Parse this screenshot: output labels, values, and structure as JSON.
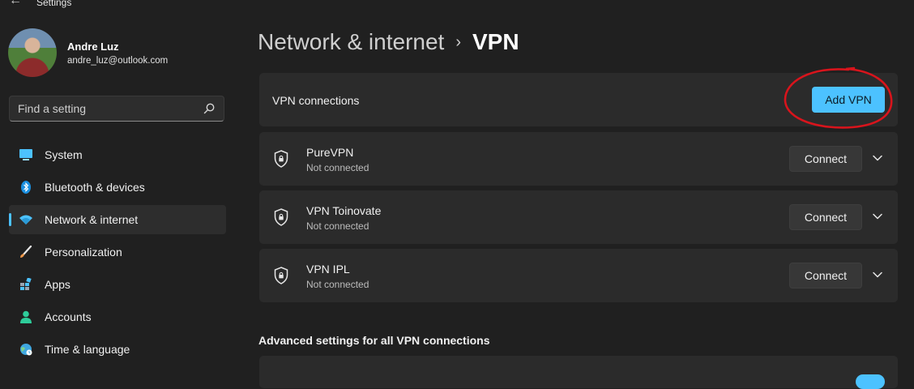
{
  "app": {
    "title": "Settings"
  },
  "user": {
    "name": "Andre Luz",
    "email": "andre_luz@outlook.com"
  },
  "search": {
    "placeholder": "Find a setting"
  },
  "sidebar": {
    "items": [
      {
        "label": "System",
        "icon": "monitor-icon"
      },
      {
        "label": "Bluetooth & devices",
        "icon": "bluetooth-icon"
      },
      {
        "label": "Network & internet",
        "icon": "wifi-icon",
        "active": true
      },
      {
        "label": "Personalization",
        "icon": "brush-icon"
      },
      {
        "label": "Apps",
        "icon": "apps-icon"
      },
      {
        "label": "Accounts",
        "icon": "person-icon"
      },
      {
        "label": "Time & language",
        "icon": "globe-clock-icon"
      }
    ]
  },
  "breadcrumb": {
    "parent": "Network & internet",
    "separator": "›",
    "current": "VPN"
  },
  "vpn_header": {
    "label": "VPN connections",
    "add_button": "Add VPN"
  },
  "connections": [
    {
      "name": "PureVPN",
      "status": "Not connected",
      "button": "Connect"
    },
    {
      "name": "VPN Toinovate",
      "status": "Not connected",
      "button": "Connect"
    },
    {
      "name": "VPN IPL",
      "status": "Not connected",
      "button": "Connect"
    }
  ],
  "advanced": {
    "title": "Advanced settings for all VPN connections"
  },
  "colors": {
    "accent": "#4cc2ff",
    "background": "#202020",
    "card": "#2b2b2b",
    "annotation": "#d8141c"
  }
}
